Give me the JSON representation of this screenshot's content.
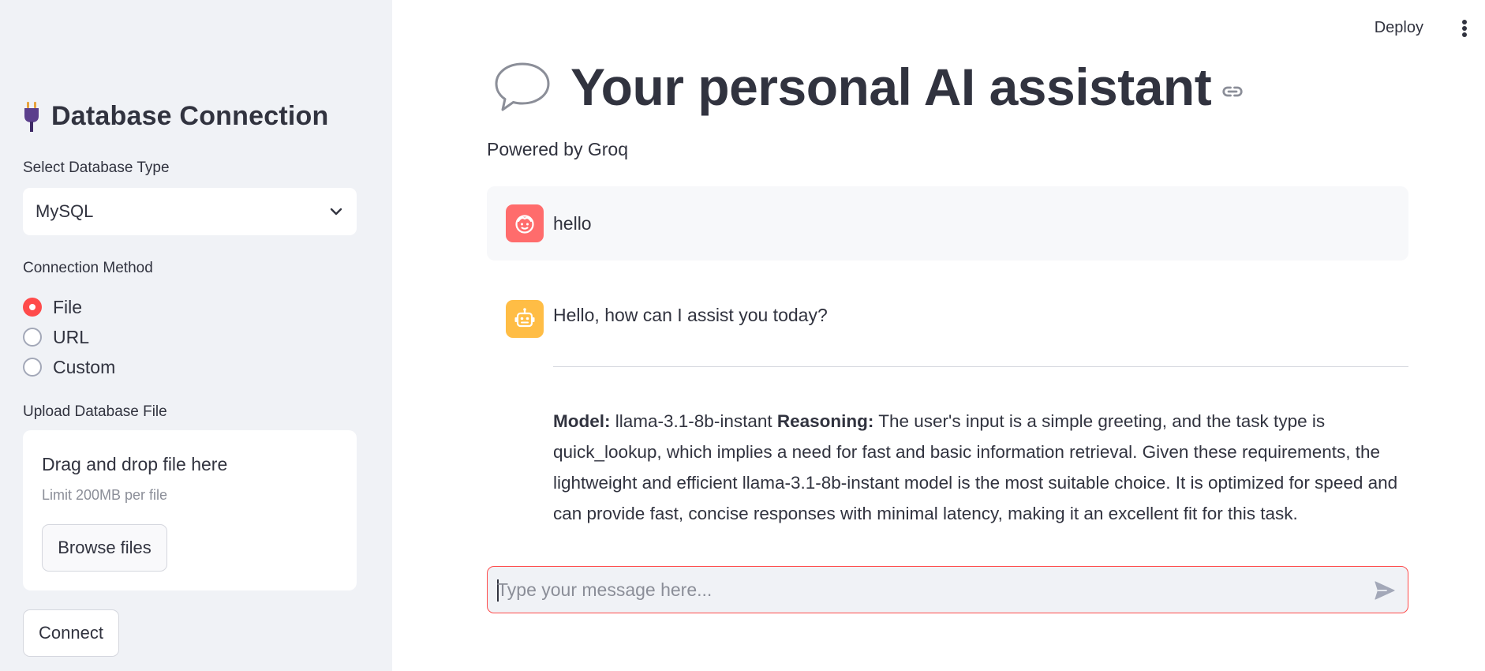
{
  "sidebar": {
    "header_icon": "plug-icon",
    "title": "Database Connection",
    "db_type": {
      "label": "Select Database Type",
      "selected": "MySQL"
    },
    "connection_method": {
      "label": "Connection Method",
      "options": [
        "File",
        "URL",
        "Custom"
      ],
      "selected": "File"
    },
    "upload": {
      "label": "Upload Database File",
      "drop_text": "Drag and drop file here",
      "limit_text": "Limit 200MB per file",
      "browse_label": "Browse files"
    },
    "connect_label": "Connect"
  },
  "header": {
    "deploy_label": "Deploy"
  },
  "main": {
    "title_icon": "speech-bubble-icon",
    "title": "Your personal AI assistant",
    "subtitle": "Powered by Groq",
    "messages": [
      {
        "role": "user",
        "avatar": "user-face-icon",
        "text": "hello"
      },
      {
        "role": "assistant",
        "avatar": "robot-icon",
        "text": "Hello, how can I assist you today?",
        "model_label": "Model:",
        "model_value": "llama-3.1-8b-instant",
        "reasoning_label": "Reasoning:",
        "reasoning_text": "The user's input is a simple greeting, and the task type is quick_lookup, which implies a need for fast and basic information retrieval. Given these requirements, the lightweight and efficient llama-3.1-8b-instant model is the most suitable choice. It is optimized for speed and can provide fast, concise responses with minimal latency, making it an excellent fit for this task."
      }
    ],
    "chat_input": {
      "placeholder": "Type your message here...",
      "value": ""
    }
  },
  "colors": {
    "accent": "#ff4b4b",
    "sidebar_bg": "#f0f2f6",
    "text": "#31333f",
    "user_avatar": "#ff6c6c",
    "bot_avatar": "#ffbd45"
  }
}
